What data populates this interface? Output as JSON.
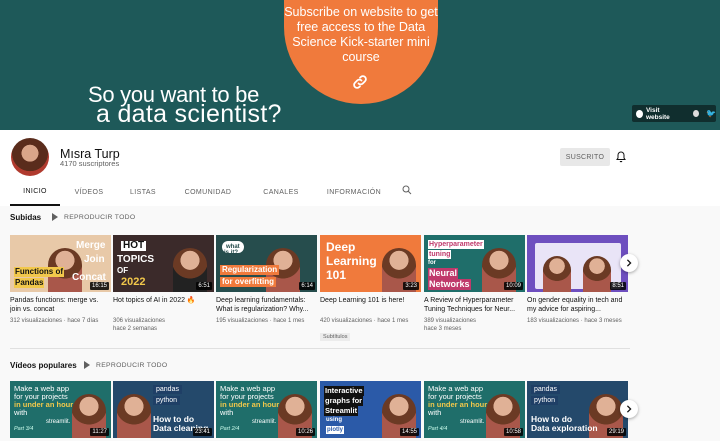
{
  "banner": {
    "promo_text": "Subscribe on website to get free access to the Data Science Kick-starter mini course",
    "headline_line1": "So you want to be",
    "headline_line2": "a data scientist?",
    "visit_label": "Visit website",
    "background_color": "#1e5959",
    "accent_color": "#f07a3c"
  },
  "channel": {
    "name": "Mısra Turp",
    "subscribers": "4170 suscriptores",
    "subscribe_label": "SUSCRITO"
  },
  "tabs": [
    {
      "label": "INICIO",
      "active": true
    },
    {
      "label": "VÍDEOS",
      "active": false
    },
    {
      "label": "LISTAS",
      "active": false
    },
    {
      "label": "COMUNIDAD",
      "active": false
    },
    {
      "label": "CANALES",
      "active": false
    },
    {
      "label": "INFORMACIÓN",
      "active": false
    }
  ],
  "uploads": {
    "title": "Subidas",
    "play_all": "REPRODUCIR TODO",
    "videos": [
      {
        "title": "Pandas functions: merge vs. join vs. concat",
        "duration": "16:15",
        "views": "312 visualizaciones",
        "age": "hace 7 días",
        "thumb_text": [
          "Merge",
          "Join",
          "Concat",
          "Functions of",
          "Pandas"
        ]
      },
      {
        "title": "Hot topics of AI in 2022 🔥",
        "duration": "6:51",
        "views": "306 visualizaciones",
        "age": "hace 2 semanas",
        "thumb_text": [
          "HOT",
          "TOPICS",
          "OF",
          "2022"
        ]
      },
      {
        "title": "Deep learning fundamentals: What is regularization? Why...",
        "duration": "6:14",
        "views": "195 visualizaciones",
        "age": "hace 1 mes",
        "thumb_text": [
          "what",
          "is it?",
          "Regularization",
          "for overfitting"
        ]
      },
      {
        "title": "Deep Learning 101 is here!",
        "duration": "3:23",
        "views": "420 visualizaciones",
        "age": "hace 1 mes",
        "badge": "Subtítulos",
        "thumb_text": [
          "Deep",
          "Learning",
          "101"
        ]
      },
      {
        "title": "A Review of Hyperparameter Tuning Techniques for Neur...",
        "duration": "10:09",
        "views": "389 visualizaciones",
        "age": "hace 3 meses",
        "thumb_text": [
          "Hyperparameter",
          "tuning",
          "for",
          "Neural",
          "Networks"
        ]
      },
      {
        "title": "On gender equality in tech and my advice for aspiring...",
        "duration": "8:51",
        "views": "183 visualizaciones",
        "age": "hace 3 meses",
        "thumb_text": []
      }
    ]
  },
  "popular": {
    "title": "Vídeos populares",
    "play_all": "REPRODUCIR TODO",
    "videos": [
      {
        "duration": "11:27",
        "thumb_text": [
          "Make a web app",
          "for your projects",
          "in under an hour",
          "with",
          "streamlit.",
          "Part 3/4"
        ]
      },
      {
        "duration": "23:41",
        "thumb_text": [
          "pandas",
          "python",
          "How to do",
          "Data cleaning"
        ]
      },
      {
        "duration": "10:26",
        "thumb_text": [
          "Make a web app",
          "for your projects",
          "in under an hour",
          "with",
          "streamlit.",
          "Part 2/4"
        ]
      },
      {
        "duration": "14:55",
        "thumb_text": [
          "Interactive",
          "graphs for",
          "Streamlit",
          "using",
          "plotly"
        ]
      },
      {
        "duration": "10:58",
        "thumb_text": [
          "Make a web app",
          "for your projects",
          "in under an hour",
          "with",
          "streamlit.",
          "Part 4/4"
        ]
      },
      {
        "duration": "29:19",
        "thumb_text": [
          "pandas",
          "python",
          "How to do",
          "Data exploration"
        ]
      }
    ]
  }
}
